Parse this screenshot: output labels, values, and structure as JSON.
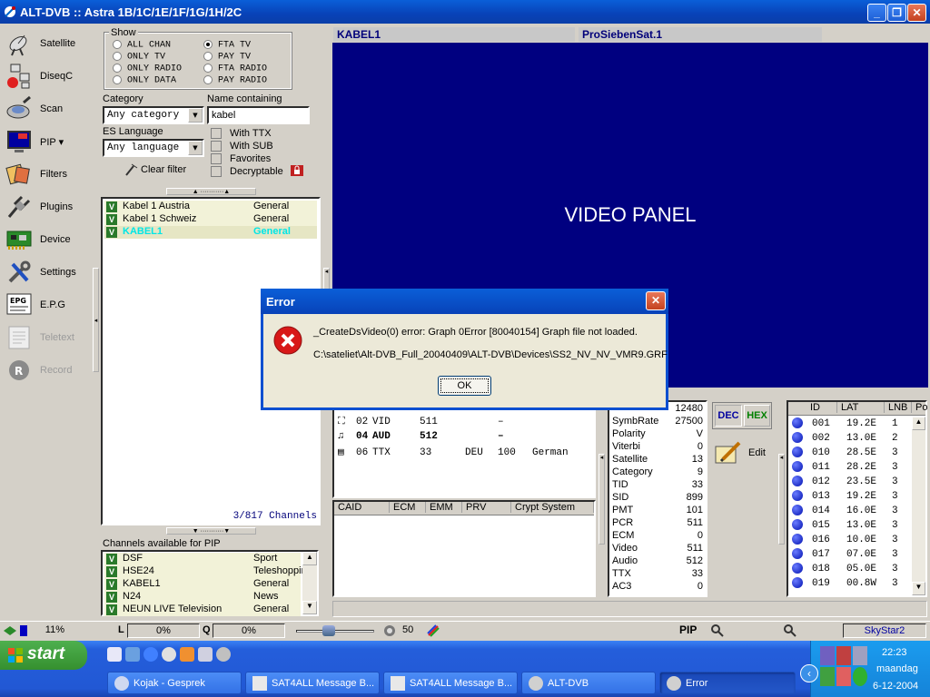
{
  "window": {
    "title": "ALT-DVB :: Astra 1B/1C/1E/1F/1G/1H/2C"
  },
  "toolbar": [
    {
      "label": "Satellite",
      "icon": "satellite-dish-icon",
      "disabled": false
    },
    {
      "label": "DiseqC",
      "icon": "diseqc-icon",
      "disabled": false
    },
    {
      "label": "Scan",
      "icon": "scan-icon",
      "disabled": false
    },
    {
      "label": "PIP ▾",
      "icon": "pip-monitor-icon",
      "disabled": false
    },
    {
      "label": "Filters",
      "icon": "filters-icon",
      "disabled": false
    },
    {
      "label": "Plugins",
      "icon": "plugins-icon",
      "disabled": false
    },
    {
      "label": "Device",
      "icon": "device-card-icon",
      "disabled": false
    },
    {
      "label": "Settings",
      "icon": "settings-tools-icon",
      "disabled": false
    },
    {
      "label": "E.P.G",
      "icon": "epg-icon",
      "disabled": false
    },
    {
      "label": "Teletext",
      "icon": "teletext-icon",
      "disabled": true
    },
    {
      "label": "Record",
      "icon": "record-icon",
      "disabled": true
    }
  ],
  "filter": {
    "show_label": "Show",
    "options": [
      {
        "label": "ALL CHAN",
        "checked": false
      },
      {
        "label": "FTA TV",
        "checked": true
      },
      {
        "label": "ONLY TV",
        "checked": false
      },
      {
        "label": "PAY TV",
        "checked": false
      },
      {
        "label": "ONLY RADIO",
        "checked": false
      },
      {
        "label": "FTA RADIO",
        "checked": false
      },
      {
        "label": "ONLY DATA",
        "checked": false
      },
      {
        "label": "PAY RADIO",
        "checked": false
      }
    ],
    "category_label": "Category",
    "category_value": "Any category",
    "name_label": "Name containing",
    "name_value": "kabel",
    "es_label": "ES Language",
    "es_value": "Any language",
    "checks": [
      "With TTX",
      "With SUB",
      "Favorites",
      "Decryptable"
    ],
    "clear_label": "Clear filter"
  },
  "channels": [
    {
      "name": "Kabel 1 Austria",
      "cat": "General"
    },
    {
      "name": "Kabel 1 Schweiz",
      "cat": "General"
    },
    {
      "name": "KABEL1",
      "cat": "General"
    }
  ],
  "channel_count": "3/817 Channels",
  "pip": {
    "label": "Channels available for PIP",
    "items": [
      {
        "name": "DSF",
        "cat": "Sport"
      },
      {
        "name": "HSE24",
        "cat": "Teleshoppin"
      },
      {
        "name": "KABEL1",
        "cat": "General"
      },
      {
        "name": "N24",
        "cat": "News"
      },
      {
        "name": "NEUN LIVE Television",
        "cat": "General"
      }
    ]
  },
  "video": {
    "channel": "KABEL1",
    "provider": "ProSiebenSat.1",
    "panel_label": "VIDEO PANEL"
  },
  "streams": [
    {
      "id": "02",
      "type": "VID",
      "pid": "511",
      "lang": "",
      "page": "–",
      "language": ""
    },
    {
      "id": "04",
      "type": "AUD",
      "pid": "512",
      "lang": "",
      "page": "–",
      "language": ""
    },
    {
      "id": "06",
      "type": "TTX",
      "pid": "33",
      "lang": "DEU",
      "page": "100",
      "language": "German"
    }
  ],
  "ca_headers": [
    "CAID",
    "ECM",
    "EMM",
    "PRV",
    "Crypt System"
  ],
  "params": [
    {
      "k": "",
      "v": "12480"
    },
    {
      "k": "SymbRate",
      "v": "27500"
    },
    {
      "k": "Polarity",
      "v": "V"
    },
    {
      "k": "Viterbi",
      "v": "0"
    },
    {
      "k": "Satellite",
      "v": "13"
    },
    {
      "k": "Category",
      "v": "9"
    },
    {
      "k": "TID",
      "v": "33"
    },
    {
      "k": "SID",
      "v": "899"
    },
    {
      "k": "PMT",
      "v": "101"
    },
    {
      "k": "PCR",
      "v": "511"
    },
    {
      "k": "ECM",
      "v": "0"
    },
    {
      "k": "Video",
      "v": "511"
    },
    {
      "k": "Audio",
      "v": "512"
    },
    {
      "k": "TTX",
      "v": "33"
    },
    {
      "k": "AC3",
      "v": "0"
    }
  ],
  "dec": "DEC",
  "hex": "HEX",
  "edit": "Edit",
  "sat_headers": [
    "ID",
    "LAT",
    "LNB",
    "Po"
  ],
  "satellites": [
    {
      "id": "001",
      "lat": "19.2E",
      "lnb": "1"
    },
    {
      "id": "002",
      "lat": "13.0E",
      "lnb": "2"
    },
    {
      "id": "010",
      "lat": "28.5E",
      "lnb": "3"
    },
    {
      "id": "011",
      "lat": "28.2E",
      "lnb": "3"
    },
    {
      "id": "012",
      "lat": "23.5E",
      "lnb": "3"
    },
    {
      "id": "013",
      "lat": "19.2E",
      "lnb": "3"
    },
    {
      "id": "014",
      "lat": "16.0E",
      "lnb": "3"
    },
    {
      "id": "015",
      "lat": "13.0E",
      "lnb": "3"
    },
    {
      "id": "016",
      "lat": "10.0E",
      "lnb": "3"
    },
    {
      "id": "017",
      "lat": "07.0E",
      "lnb": "3"
    },
    {
      "id": "018",
      "lat": "05.0E",
      "lnb": "3"
    },
    {
      "id": "019",
      "lat": "00.8W",
      "lnb": "3"
    }
  ],
  "status": {
    "signal": "11%",
    "l_label": "L",
    "l_val": "0%",
    "q_label": "Q",
    "q_val": "0%",
    "volume": "50",
    "pip": "PIP",
    "device": "SkyStar2",
    "volume_level": 0.42
  },
  "dialog": {
    "title": "Error",
    "message": "_CreateDsVideo(0) error: Graph 0Error [80040154] Graph file not loaded.",
    "path": "C:\\sateliet\\Alt-DVB_Full_20040409\\ALT-DVB\\Devices\\SS2_NV_NV_VMR9.GRF",
    "ok": "OK"
  },
  "taskbar": {
    "start": "start",
    "tasks": [
      {
        "label": "Kojak - Gesprek",
        "active": false
      },
      {
        "label": "SAT4ALL Message B...",
        "active": false
      },
      {
        "label": "SAT4ALL Message B...",
        "active": false
      },
      {
        "label": "ALT-DVB",
        "active": false
      },
      {
        "label": "Error",
        "active": true
      }
    ],
    "time": "22:23",
    "day": "maandag",
    "date": "6-12-2004"
  }
}
